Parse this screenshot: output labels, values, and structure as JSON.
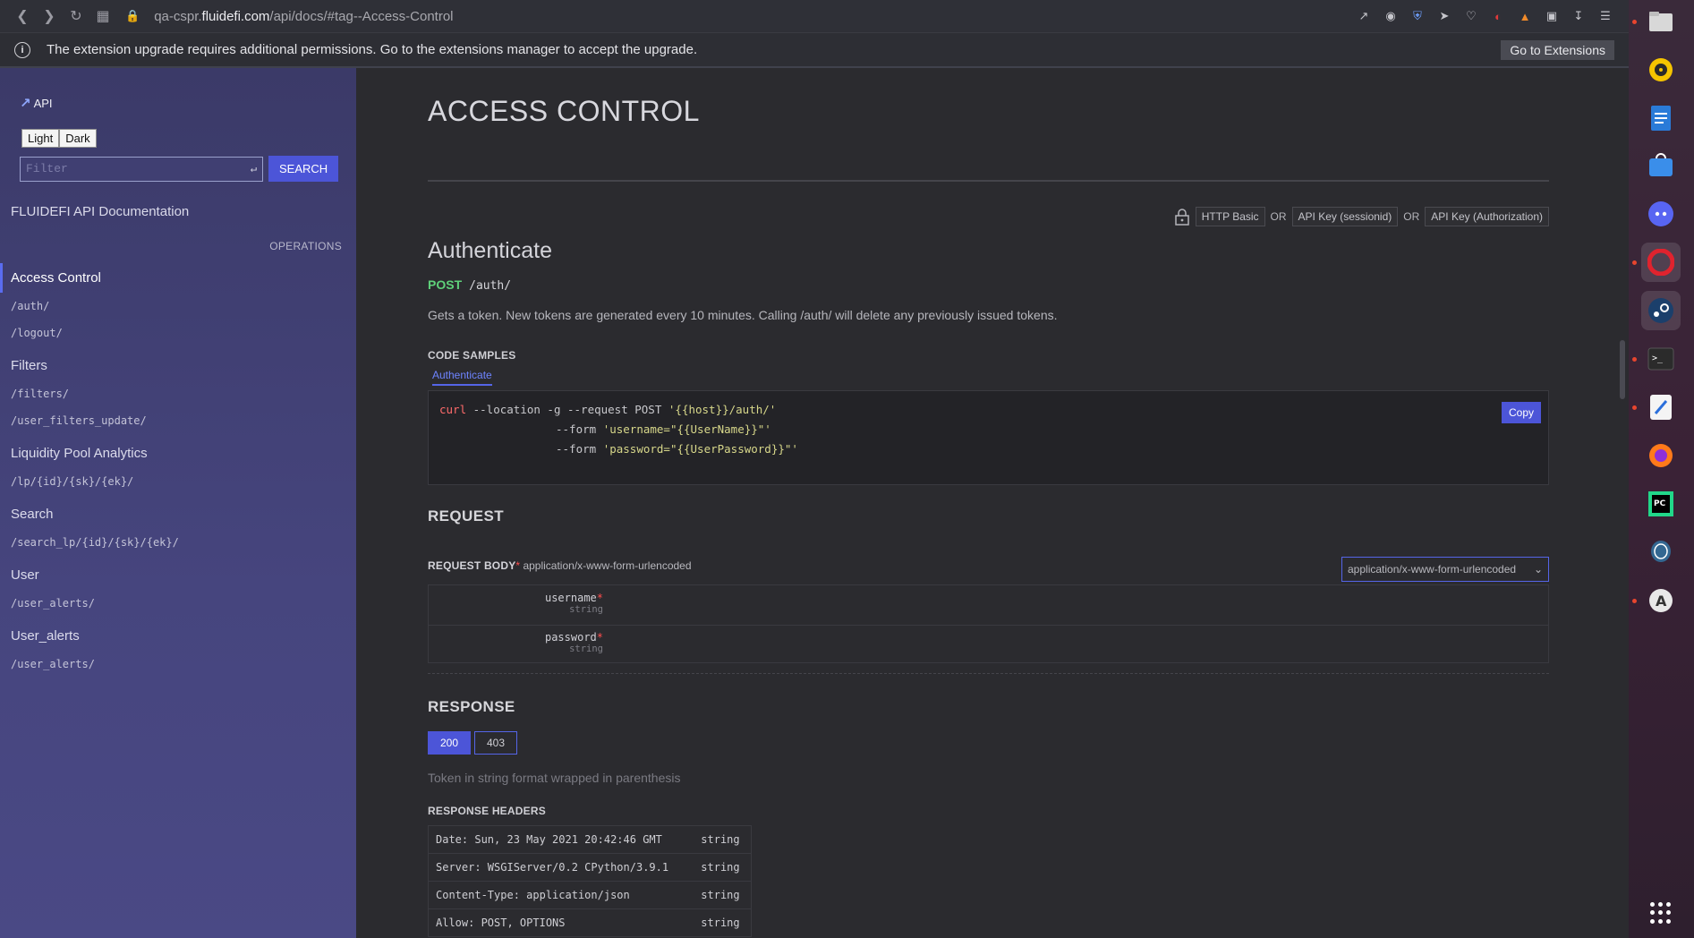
{
  "browser": {
    "url_prefix": "qa-cspr.",
    "url_host": "fluidefi.com",
    "url_path": "/api/docs/#tag--Access-Control"
  },
  "notice": {
    "text": "The extension upgrade requires additional permissions. Go to the extensions manager to accept the upgrade.",
    "button": "Go to Extensions"
  },
  "sidebar": {
    "logo": "API",
    "theme_light": "Light",
    "theme_dark": "Dark",
    "filter_placeholder": "Filter",
    "search_button": "SEARCH",
    "doc_title": "FLUIDEFI API Documentation",
    "operations_label": "OPERATIONS",
    "groups": [
      {
        "label": "Access Control",
        "links": [
          "/auth/",
          "/logout/"
        ]
      },
      {
        "label": "Filters",
        "links": [
          "/filters/",
          "/user_filters_update/"
        ]
      },
      {
        "label": "Liquidity Pool Analytics",
        "links": [
          "/lp/{id}/{sk}/{ek}/"
        ]
      },
      {
        "label": "Search",
        "links": [
          "/search_lp/{id}/{sk}/{ek}/"
        ]
      },
      {
        "label": "User",
        "links": [
          "/user_alerts/"
        ]
      },
      {
        "label": "User_alerts",
        "links": [
          "/user_alerts/"
        ]
      }
    ]
  },
  "main": {
    "page_title": "ACCESS CONTROL",
    "auth": {
      "methods": [
        "HTTP Basic",
        "API Key (sessionid)",
        "API Key (Authorization)"
      ],
      "separator": "OR"
    },
    "operation": {
      "title": "Authenticate",
      "method": "POST",
      "path": "/auth/",
      "description": "Gets a token. New tokens are generated every 10 minutes. Calling /auth/ will delete any previously issued tokens."
    },
    "code_samples": {
      "label": "CODE SAMPLES",
      "tab": "Authenticate",
      "line1_cmd": "curl",
      "line1_rest": " --location -g --request POST ",
      "line1_url": "'{{host}}/auth/'",
      "line2_flag": "--form ",
      "line2_val": "'username=\"{{UserName}}\"'",
      "line3_flag": "--form ",
      "line3_val": "'password=\"{{UserPassword}}\"'",
      "copy": "Copy"
    },
    "request": {
      "title": "REQUEST",
      "body_label": "REQUEST BODY",
      "required_mark": "*",
      "content_type": "application/x-www-form-urlencoded",
      "select_value": "application/x-www-form-urlencoded",
      "params": [
        {
          "name": "username",
          "type": "string"
        },
        {
          "name": "password",
          "type": "string"
        }
      ]
    },
    "response": {
      "title": "RESPONSE",
      "codes": [
        "200",
        "403"
      ],
      "description": "Token in string format wrapped in parenthesis",
      "headers_label": "RESPONSE HEADERS",
      "headers": [
        {
          "name": "Date: Sun, 23 May 2021 20:42:46 GMT",
          "type": "string"
        },
        {
          "name": "Server: WSGIServer/0.2 CPython/3.9.1",
          "type": "string"
        },
        {
          "name": "Content-Type: application/json",
          "type": "string"
        },
        {
          "name": "Allow: POST, OPTIONS",
          "type": "string"
        }
      ]
    }
  },
  "colors": {
    "accent": "#4c55d8",
    "post_method": "#5fd17a",
    "required": "#ff4d4d",
    "sidebar_bg": "#3b3a68"
  }
}
